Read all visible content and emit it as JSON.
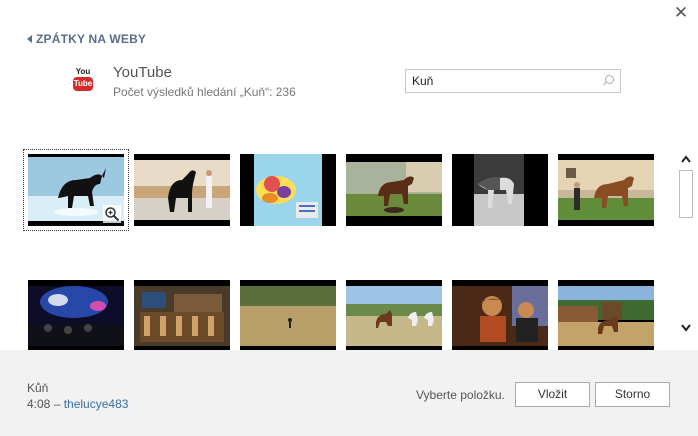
{
  "dialog": {
    "close_glyph": "✕",
    "back_label": "ZPÁTKY NA WEBY"
  },
  "provider": {
    "logo_you": "You",
    "logo_tube": "Tube",
    "name": "YouTube",
    "result_text": "Počet výsledků hledání „Kuň“: 236"
  },
  "search": {
    "value": "Kuň"
  },
  "results": {
    "thumbnails": [
      {
        "row": 1,
        "col": 1,
        "icon": "video-thumbnail",
        "selected": true
      },
      {
        "row": 1,
        "col": 2,
        "icon": "video-thumbnail",
        "selected": false
      },
      {
        "row": 1,
        "col": 3,
        "icon": "video-thumbnail",
        "selected": false
      },
      {
        "row": 1,
        "col": 4,
        "icon": "video-thumbnail",
        "selected": false
      },
      {
        "row": 1,
        "col": 5,
        "icon": "video-thumbnail",
        "selected": false
      },
      {
        "row": 1,
        "col": 6,
        "icon": "video-thumbnail",
        "selected": false
      },
      {
        "row": 2,
        "col": 1,
        "icon": "video-thumbnail",
        "selected": false
      },
      {
        "row": 2,
        "col": 2,
        "icon": "video-thumbnail",
        "selected": false
      },
      {
        "row": 2,
        "col": 3,
        "icon": "video-thumbnail",
        "selected": false
      },
      {
        "row": 2,
        "col": 4,
        "icon": "video-thumbnail",
        "selected": false
      },
      {
        "row": 2,
        "col": 5,
        "icon": "video-thumbnail",
        "selected": false
      },
      {
        "row": 2,
        "col": 6,
        "icon": "video-thumbnail",
        "selected": false
      }
    ]
  },
  "selection": {
    "title": "Kůň",
    "duration": "4:08",
    "separator": " – ",
    "author": "thelucye483"
  },
  "footer": {
    "status": "Vyberte položku.",
    "insert_label": "Vložit",
    "cancel_label": "Storno"
  },
  "colors": {
    "accent_link": "#3a6ea5",
    "back_link": "#5a6e8a",
    "youtube_red": "#d42b2b",
    "footer_bg": "#f2f2f2"
  }
}
